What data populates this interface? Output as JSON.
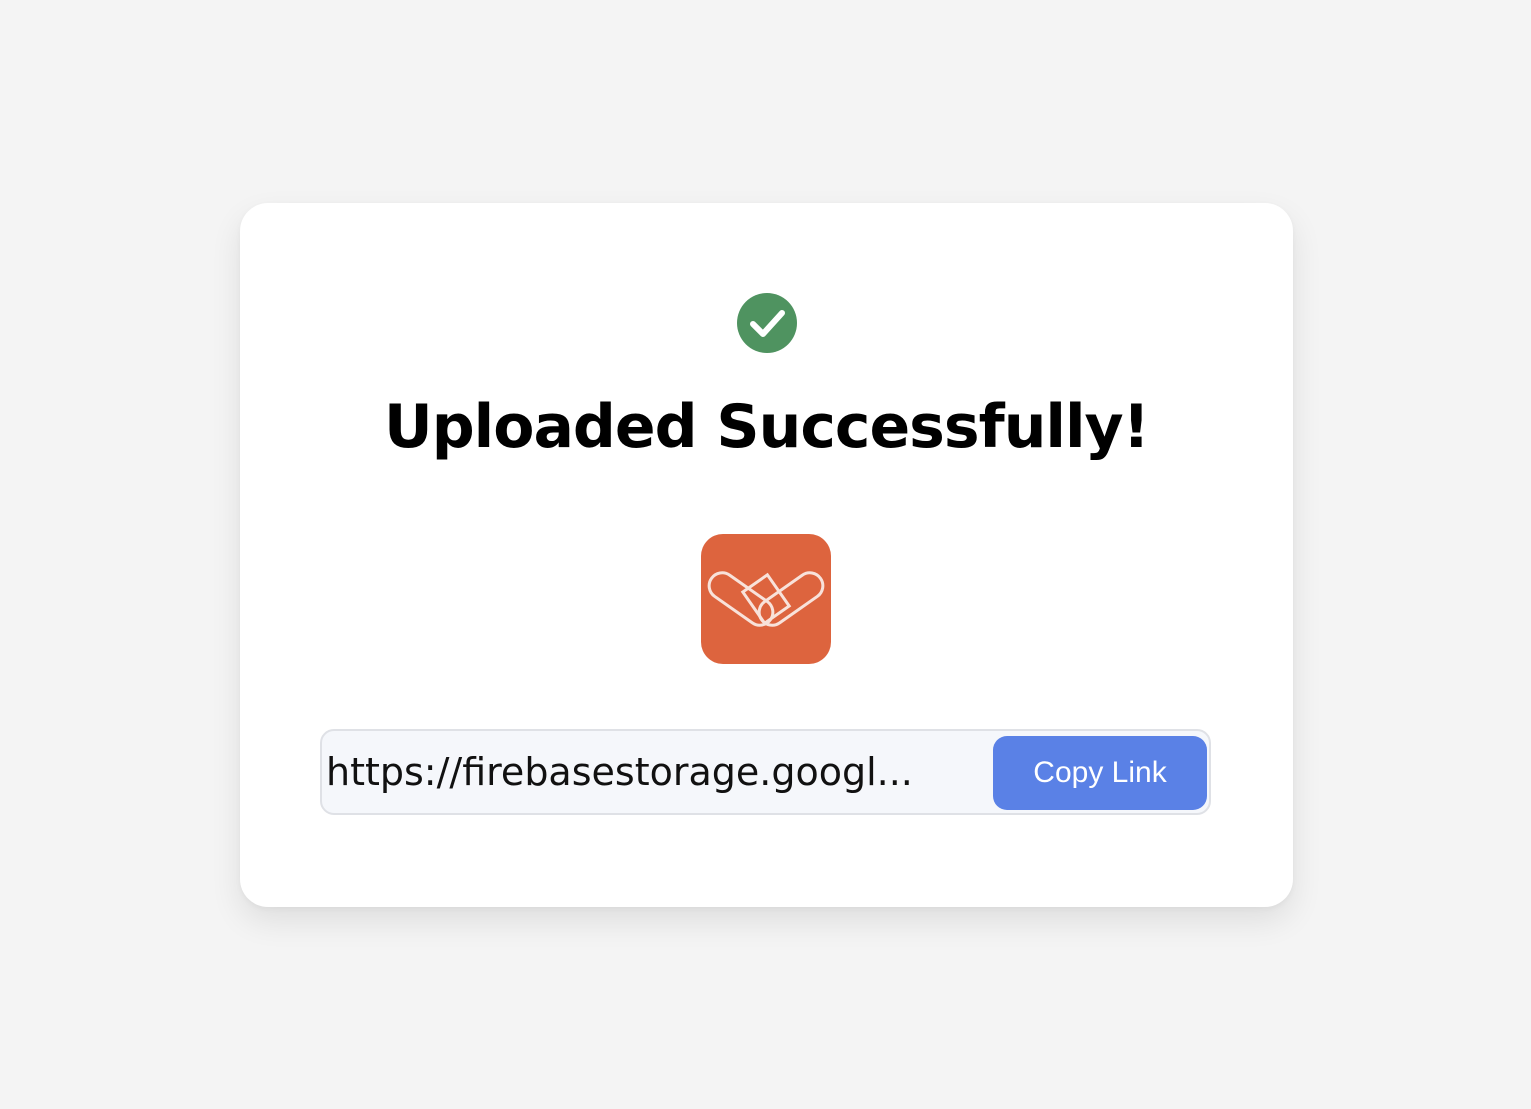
{
  "card": {
    "title": "Uploaded Successfully!",
    "success_icon": "check-circle-icon",
    "thumbnail_icon": "app-logo-icon",
    "link": {
      "value": "https://firebasestorage.googl..."
    },
    "copy_button_label": "Copy Link"
  },
  "colors": {
    "background": "#f4f4f4",
    "card": "#ffffff",
    "success": "#4f9360",
    "thumbnail": "#dd643e",
    "button": "#5a81e6"
  }
}
